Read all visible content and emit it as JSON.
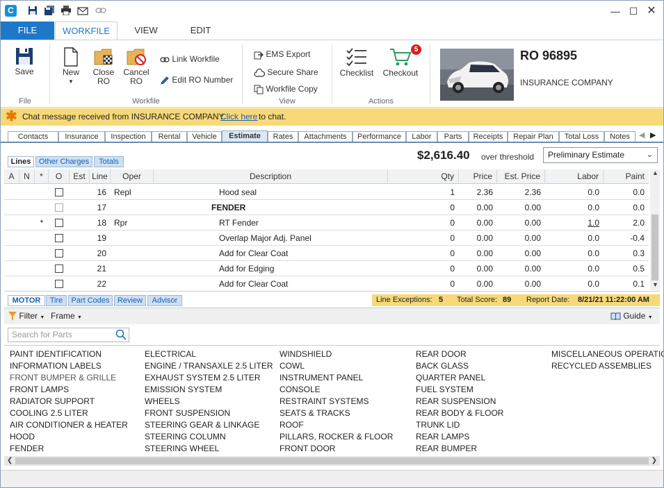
{
  "titlebar": {
    "app_icon": "C",
    "quick_access": [
      "save-icon",
      "save-all-icon",
      "print-icon",
      "email-icon",
      "link-icon"
    ]
  },
  "ribbon_tabs": [
    "FILE",
    "WORKFILE",
    "VIEW",
    "EDIT"
  ],
  "ribbon": {
    "file_group": {
      "label": "File",
      "save": "Save"
    },
    "workfile_group": {
      "label": "Workfile",
      "new": "New",
      "close_l1": "Close",
      "close_l2": "RO",
      "cancel_l1": "Cancel",
      "cancel_l2": "RO",
      "link": "Link Workfile",
      "edit_ro": "Edit RO Number"
    },
    "view_group": {
      "label": "View",
      "ems": "EMS Export",
      "secure": "Secure Share",
      "copy": "Workfile Copy"
    },
    "actions_group": {
      "label": "Actions",
      "checklist": "Checklist",
      "checkout": "Checkout",
      "checkout_badge": "5"
    },
    "ro": {
      "number": "RO 96895",
      "company": "INSURANCE COMPANY"
    }
  },
  "chat": {
    "message": "Chat message received from INSURANCE COMPANY.",
    "link": "Click here",
    "suffix": "to chat."
  },
  "module_tabs": [
    "Contacts",
    "Insurance",
    "Inspection",
    "Rental",
    "Vehicle",
    "Estimate",
    "Rates",
    "Attachments",
    "Performance",
    "Labor",
    "Parts",
    "Receipts",
    "Repair Plan",
    "Total Loss",
    "Notes"
  ],
  "sub_tabs": [
    "Lines",
    "Other Charges",
    "Totals"
  ],
  "estimate": {
    "total": "$2,616.40",
    "threshold": "over threshold",
    "type": "Preliminary Estimate"
  },
  "grid": {
    "headers": [
      "A",
      "N",
      "*",
      "O",
      "Est",
      "Line",
      "Oper",
      "Description",
      "Qty",
      "Price",
      "Est. Price",
      "Labor",
      "Paint"
    ],
    "rows": [
      {
        "star": "",
        "check": true,
        "line": "16",
        "oper": "Repl",
        "desc": "Hood seal",
        "bold": false,
        "qty": "1",
        "price": "2.36",
        "est": "2.36",
        "labor": "0.0",
        "labor_ul": false,
        "paint": "0.0"
      },
      {
        "star": "",
        "check": true,
        "dim": true,
        "line": "17",
        "oper": "",
        "desc": "FENDER",
        "bold": true,
        "qty": "0",
        "price": "0.00",
        "est": "0.00",
        "labor": "0.0",
        "labor_ul": false,
        "paint": "0.0"
      },
      {
        "star": "*",
        "check": true,
        "line": "18",
        "oper": "Rpr",
        "desc": "RT Fender",
        "bold": false,
        "qty": "0",
        "price": "0.00",
        "est": "0.00",
        "labor": "1.0",
        "labor_ul": true,
        "paint": "2.0"
      },
      {
        "star": "",
        "check": true,
        "line": "19",
        "oper": "",
        "desc": "Overlap Major Adj. Panel",
        "bold": false,
        "qty": "0",
        "price": "0.00",
        "est": "0.00",
        "labor": "0.0",
        "labor_ul": false,
        "paint": "-0.4"
      },
      {
        "star": "",
        "check": true,
        "line": "20",
        "oper": "",
        "desc": "Add for Clear Coat",
        "bold": false,
        "qty": "0",
        "price": "0.00",
        "est": "0.00",
        "labor": "0.0",
        "labor_ul": false,
        "paint": "0.3"
      },
      {
        "star": "",
        "check": true,
        "line": "21",
        "oper": "",
        "desc": "Add for Edging",
        "bold": false,
        "qty": "0",
        "price": "0.00",
        "est": "0.00",
        "labor": "0.0",
        "labor_ul": false,
        "paint": "0.5"
      },
      {
        "star": "",
        "check": true,
        "line": "22",
        "oper": "",
        "desc": "Add for Clear Coat",
        "bold": false,
        "qty": "0",
        "price": "0.00",
        "est": "0.00",
        "labor": "0.0",
        "labor_ul": false,
        "paint": "0.1"
      }
    ]
  },
  "bottom_tabs": [
    "MOTOR",
    "Tire",
    "Part Codes",
    "Review",
    "Advisor"
  ],
  "stats": {
    "exceptions_label": "Line Exceptions:",
    "exceptions": "5",
    "score_label": "Total Score:",
    "score": "89",
    "date_label": "Report Date:",
    "date": "8/21/21 11:22:00 AM"
  },
  "toolbar": {
    "filter": "Filter",
    "frame": "Frame",
    "guide": "Guide"
  },
  "search": {
    "placeholder": "Search for Parts"
  },
  "parts_columns": [
    [
      "PAINT IDENTIFICATION",
      "INFORMATION LABELS",
      "FRONT BUMPER & GRILLE",
      "FRONT LAMPS",
      "RADIATOR SUPPORT",
      "COOLING 2.5 LITER",
      "AIR CONDITIONER & HEATER",
      "HOOD",
      "FENDER"
    ],
    [
      "ELECTRICAL",
      "ENGINE / TRANSAXLE 2.5 LITER",
      "EXHAUST SYSTEM 2.5 LITER",
      "EMISSION SYSTEM",
      "WHEELS",
      "FRONT SUSPENSION",
      "STEERING GEAR & LINKAGE",
      "STEERING COLUMN",
      "STEERING WHEEL"
    ],
    [
      "WINDSHIELD",
      "COWL",
      "INSTRUMENT PANEL",
      "CONSOLE",
      "RESTRAINT SYSTEMS",
      "SEATS & TRACKS",
      "ROOF",
      "PILLARS, ROCKER & FLOOR",
      "FRONT DOOR"
    ],
    [
      "REAR DOOR",
      "BACK GLASS",
      "QUARTER PANEL",
      "FUEL SYSTEM",
      "REAR SUSPENSION",
      "REAR BODY & FLOOR",
      "TRUNK LID",
      "REAR LAMPS",
      "REAR BUMPER"
    ],
    [
      "MISCELLANEOUS OPERATIONS",
      "RECYCLED ASSEMBLIES"
    ]
  ],
  "colors": {
    "accent": "#1e78c8",
    "chat": "#f7d97a",
    "badge": "#d81e1e"
  }
}
